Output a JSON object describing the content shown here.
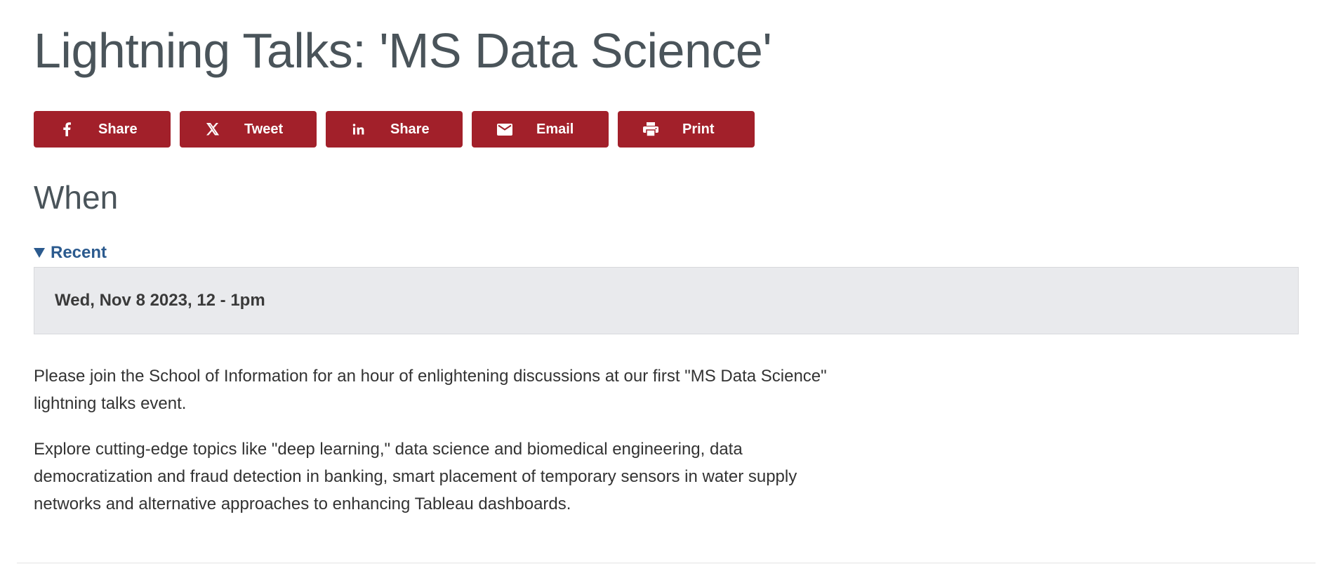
{
  "page": {
    "title": "Lightning Talks: 'MS Data Science'"
  },
  "share_bar": {
    "buttons": [
      {
        "icon": "facebook-icon",
        "label": "Share"
      },
      {
        "icon": "x-twitter-icon",
        "label": "Tweet"
      },
      {
        "icon": "linkedin-icon",
        "label": "Share"
      },
      {
        "icon": "email-icon",
        "label": "Email"
      },
      {
        "icon": "print-icon",
        "label": "Print"
      }
    ],
    "button_color": "#a2202a"
  },
  "when": {
    "heading": "When",
    "disclosure_label": "Recent",
    "date": "Wed, Nov 8 2023, 12 - 1pm"
  },
  "description": {
    "paragraphs": [
      "Please join the School of Information for an hour of enlightening discussions at our first \"MS Data Science\" lightning talks event.",
      "Explore cutting-edge topics like \"deep learning,\" data science and biomedical engineering, data democratization and fraud detection in banking, smart placement of temporary sensors in water supply networks and alternative approaches to enhancing Tableau dashboards."
    ]
  },
  "colors": {
    "heading": "#4a545a",
    "link": "#2b5a8e",
    "date_box_bg": "#e9eaed"
  }
}
